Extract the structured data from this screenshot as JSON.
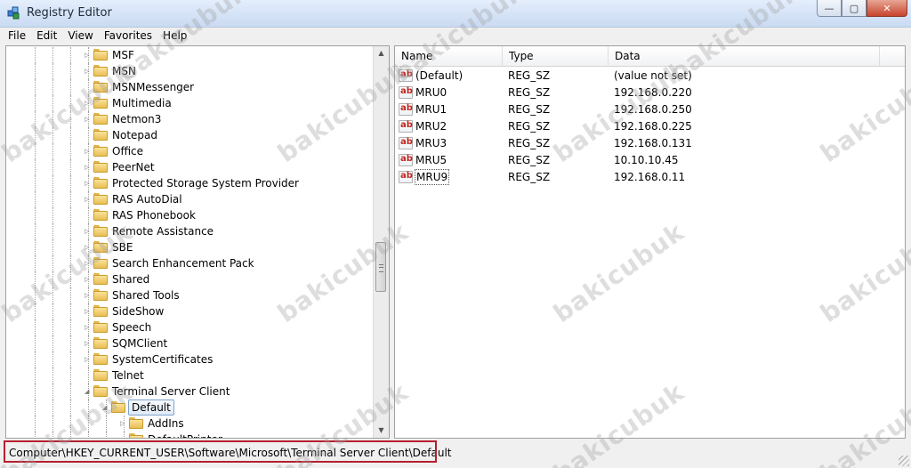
{
  "window": {
    "title": "Registry Editor",
    "controls": {
      "minimize": "—",
      "maximize": "▢",
      "close": "✕"
    }
  },
  "menu": [
    "File",
    "Edit",
    "View",
    "Favorites",
    "Help"
  ],
  "tree": {
    "items": [
      {
        "label": "MSF",
        "expander": "▷"
      },
      {
        "label": "MSN",
        "expander": "▷"
      },
      {
        "label": "MSNMessenger",
        "expander": ""
      },
      {
        "label": "Multimedia",
        "expander": "▷"
      },
      {
        "label": "Netmon3",
        "expander": "▷"
      },
      {
        "label": "Notepad",
        "expander": ""
      },
      {
        "label": "Office",
        "expander": "▷"
      },
      {
        "label": "PeerNet",
        "expander": "▷"
      },
      {
        "label": "Protected Storage System Provider",
        "expander": "▷"
      },
      {
        "label": "RAS AutoDial",
        "expander": "▷"
      },
      {
        "label": "RAS Phonebook",
        "expander": ""
      },
      {
        "label": "Remote Assistance",
        "expander": "▷"
      },
      {
        "label": "SBE",
        "expander": "▷"
      },
      {
        "label": "Search Enhancement Pack",
        "expander": "▷"
      },
      {
        "label": "Shared",
        "expander": "▷"
      },
      {
        "label": "Shared Tools",
        "expander": "▷"
      },
      {
        "label": "SideShow",
        "expander": "▷"
      },
      {
        "label": "Speech",
        "expander": "▷"
      },
      {
        "label": "SQMClient",
        "expander": "▷"
      },
      {
        "label": "SystemCertificates",
        "expander": "▷"
      },
      {
        "label": "Telnet",
        "expander": ""
      },
      {
        "label": "Terminal Server Client",
        "expander": "◢"
      },
      {
        "label": "Default",
        "expander": "◢"
      },
      {
        "label": "AddIns",
        "expander": "▷"
      },
      {
        "label": "DefaultPrinter",
        "expander": ""
      }
    ]
  },
  "list": {
    "columns": [
      "Name",
      "Type",
      "Data"
    ],
    "icon_text": "ab",
    "rows": [
      {
        "name": "(Default)",
        "type": "REG_SZ",
        "data": "(value not set)"
      },
      {
        "name": "MRU0",
        "type": "REG_SZ",
        "data": "192.168.0.220"
      },
      {
        "name": "MRU1",
        "type": "REG_SZ",
        "data": "192.168.0.250"
      },
      {
        "name": "MRU2",
        "type": "REG_SZ",
        "data": "192.168.0.225"
      },
      {
        "name": "MRU3",
        "type": "REG_SZ",
        "data": "192.168.0.131"
      },
      {
        "name": "MRU5",
        "type": "REG_SZ",
        "data": "10.10.10.45"
      },
      {
        "name": "MRU9",
        "type": "REG_SZ",
        "data": "192.168.0.11"
      }
    ]
  },
  "status": {
    "path": "Computer\\HKEY_CURRENT_USER\\Software\\Microsoft\\Terminal Server Client\\Default"
  },
  "watermark": "bakicubuk",
  "colors": {
    "highlight_border": "#b5202e",
    "icon_text": "#c0251f"
  }
}
